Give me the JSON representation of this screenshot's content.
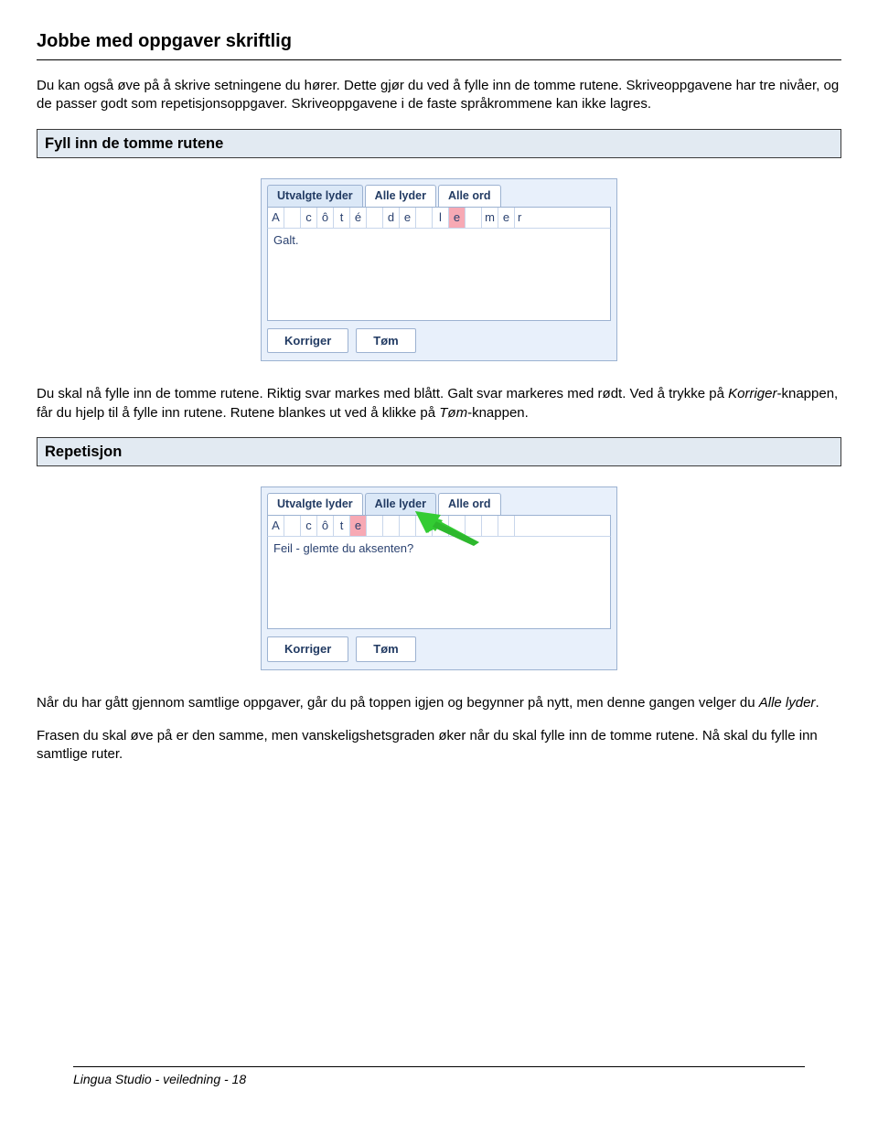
{
  "title": "Jobbe med oppgaver skriftlig",
  "intro": "Du kan også øve på å skrive setningene du hører. Dette gjør du ved å fylle inn de tomme rutene. Skriveoppgavene har tre nivåer, og de passer godt som repetisjonsoppgaver. Skriveoppgavene i de faste språkrommene kan ikke lagres.",
  "section1": {
    "heading": "Fyll inn de tomme rutene",
    "after": "Du skal nå fylle inn de tomme rutene. Riktig svar markes med blått. Galt svar markeres med rødt. Ved å trykke på Korriger-knappen, får du hjelp til å fylle inn rutene. Rutene blankes ut ved å klikke på Tøm-knappen."
  },
  "section2": {
    "heading": "Repetisjon",
    "after1": "Når du har gått gjennom samtlige oppgaver, går du på toppen igjen og begynner på nytt, men denne gangen velger du Alle lyder.",
    "after2": "Frasen du skal øve på er den samme, men vanskeligshetsgraden øker når du skal fylle inn de tomme rutene. Nå skal du fylle inn samtlige ruter."
  },
  "panel1": {
    "tabs": {
      "t1": "Utvalgte lyder",
      "t2": "Alle lyder",
      "t3": "Alle ord"
    },
    "cells": [
      "A",
      "",
      "c",
      "ô",
      "t",
      "é",
      "",
      "d",
      "e",
      "",
      "l",
      "e",
      "",
      "m",
      "e",
      "r"
    ],
    "bad_index": 11,
    "feedback": "Galt.",
    "btn_korriger": "Korriger",
    "btn_tom": "Tøm"
  },
  "panel2": {
    "tabs": {
      "t1": "Utvalgte lyder",
      "t2": "Alle lyder",
      "t3": "Alle ord"
    },
    "cells": [
      "A",
      "",
      "c",
      "ô",
      "t",
      "e",
      "",
      "",
      "",
      "",
      "",
      "",
      "",
      "",
      "",
      ""
    ],
    "bad_index": 5,
    "feedback": "Feil - glemte du aksenten?",
    "btn_korriger": "Korriger",
    "btn_tom": "Tøm"
  },
  "footer": "Lingua Studio - veiledning - 18"
}
